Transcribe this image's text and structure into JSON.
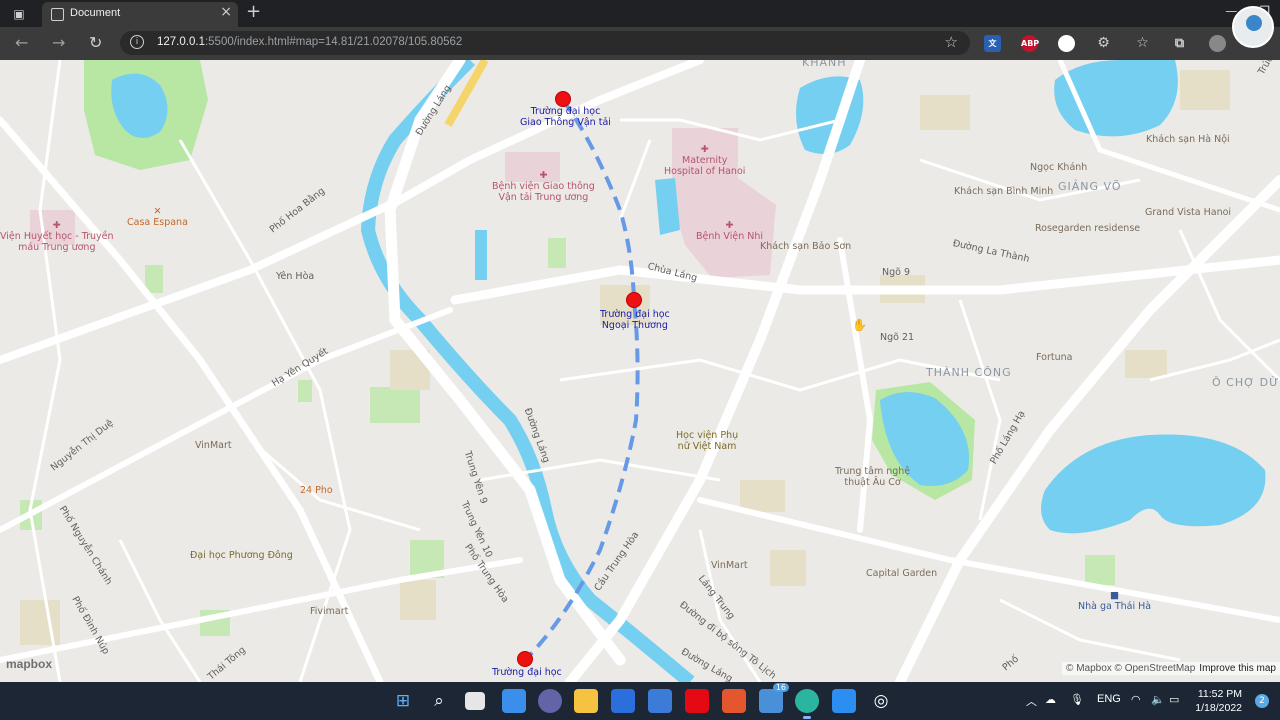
{
  "browser": {
    "tab_title": "Document",
    "url_host": "127.0.0.1",
    "url_rest": ":5500/index.html#map=14.81/21.02078/105.80562",
    "extension_abp": "ABP"
  },
  "map": {
    "zoom": 14.81,
    "center_lat": 21.02078,
    "center_lng": 105.80562,
    "route_color": "#6699e6",
    "marker_color": "#ee1111",
    "water_color": "#75cff0",
    "park_color": "#b8e6a3",
    "route_points": [
      {
        "name": "Trường đại học Giao Thông Vận tải"
      },
      {
        "name": "Trường đại học Ngoại Thương"
      },
      {
        "name": "Trường đại học"
      }
    ],
    "labels": {
      "khanh": "KHÁNH",
      "duong_lang_top": "Đường Láng",
      "gtvt_1": "Trường đại học",
      "gtvt_2": "Giao Thông Vận tải",
      "maternity_1": "Maternity",
      "maternity_2": "Hospital of Hanoi",
      "bv_gt_1": "Bệnh viện Giao thông",
      "bv_gt_2": "Vận tải Trung ương",
      "bv_nhi": "Bệnh Viện Nhi",
      "ks_bao_son": "Khách sạn Bảo Sơn",
      "ks_hanoi": "Khách sạn Hà Nội",
      "ngoc_khanh": "Ngọc Khánh",
      "ks_binh_minh": "Khách sạn Bình Minh",
      "giang_vo": "GIẢNG VÕ",
      "grand_vista": "Grand Vista Hanoi",
      "rosegarden": "Rosegarden residense",
      "duong_la_thanh": "Đường La Thành",
      "ngo_9": "Ngõ 9",
      "ngo_21": "Ngõ 21",
      "chua_lang": "Chùa Láng",
      "ftu_1": "Trường đại học",
      "ftu_2": "Ngoại Thương",
      "vien_huyet_hoc_1": "Viện Huyết học - Truyền",
      "vien_huyet_hoc_2": "máu Trung ương",
      "casa_espana": "Casa Espana",
      "pho_hoa_bang": "Phố Hoa Bằng",
      "yen_hoa": "Yên Hòa",
      "ha_yen_quyet": "Hạ Yên Quyết",
      "thanh_cong": "THÀNH CÔNG",
      "fortuna": "Fortuna",
      "o_cho_dua": "Ô CHỢ DỪ",
      "nguyen_thi_due": "Nguyễn Thị Duệ",
      "vinmart_1": "VinMart",
      "duong_lang_mid": "Đường Láng",
      "hv_phu_nu_1": "Học viện Phụ",
      "hv_phu_nu_2": "nữ Việt Nam",
      "trung_tam_1": "Trung tâm nghệ",
      "trung_tam_2": "thuật Âu Cơ",
      "pho_lang_ha": "Phố Láng Hạ",
      "pho_24": "24 Pho",
      "trung_yen_9": "Trung Yên 9",
      "trung_yen_10": "Trung Yên 10",
      "pho_trung_hoa": "Phố Trung Hòa",
      "cau_trung_hoa": "Cầu Trung Hòa",
      "pho_nguyen_chanh": "Phố Nguyễn Chánh",
      "dh_phuong_dong": "Đại học Phương Đông",
      "vinmart_2": "VinMart",
      "capital_garden": "Capital Garden",
      "nha_ga": "Nhà ga Thái Hà",
      "lang_trung": "Láng Trung",
      "duong_di_bo": "Đường đi bộ sông Tô Lịch",
      "duong_lang_bottom": "Đường Láng",
      "pho_dinh_nup": "Phố Đình Núp",
      "fivimart": "Fivimart",
      "thai_tong": "Thái Tông",
      "dh_bottom": "Trường đại học",
      "pho_bottom": "Phố",
      "truc": "Trúc"
    },
    "mapbox_logo": "mapbox",
    "attribution_1": "© Mapbox © OpenStreetMap",
    "attribution_2": "Improve this map"
  },
  "taskbar": {
    "lang": "ENG",
    "time": "11:52 PM",
    "date": "1/18/2022",
    "badge_16": "16",
    "notification_count": "2"
  }
}
